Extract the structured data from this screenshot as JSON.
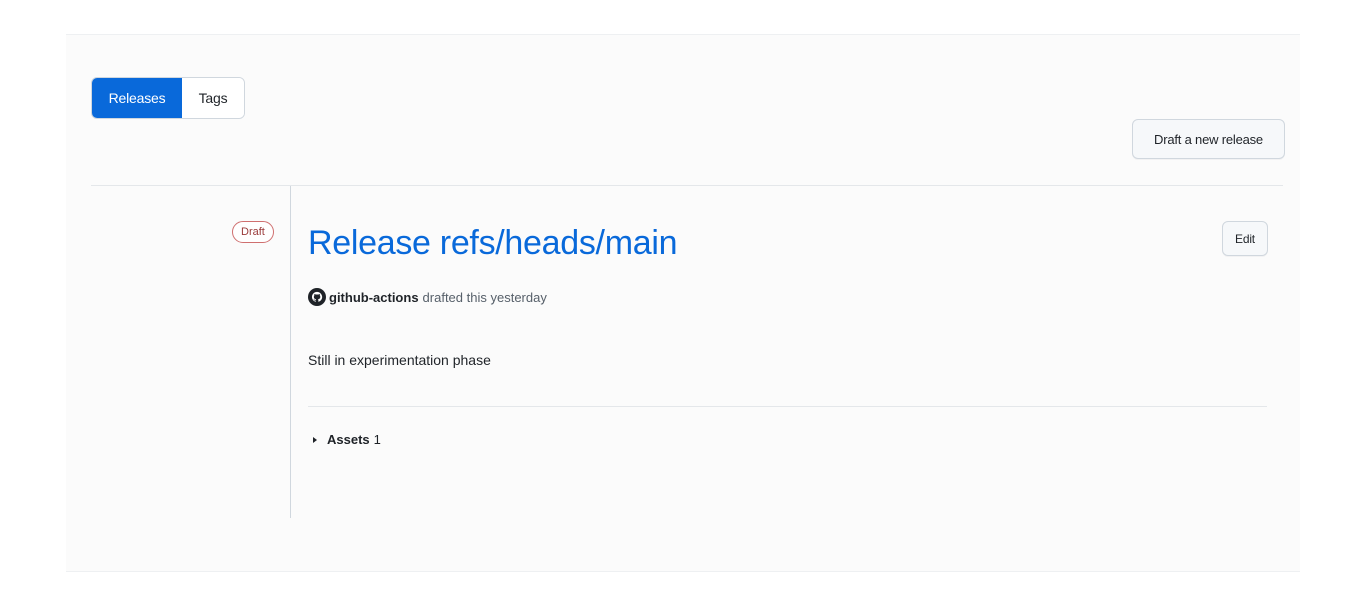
{
  "subnav": {
    "releases_label": "Releases",
    "tags_label": "Tags"
  },
  "actions": {
    "draft_new_release_label": "Draft a new release"
  },
  "release": {
    "status_badge": "Draft",
    "title": "Release refs/heads/main",
    "author": "github-actions",
    "byline_suffix": "drafted this yesterday",
    "body": "Still in experimentation phase",
    "edit_label": "Edit",
    "assets_label": "Assets",
    "assets_count": "1"
  },
  "colors": {
    "accent": "#0969da",
    "draft_badge": "#cf6f6f"
  },
  "icons": {
    "avatar": "github-avatar-icon",
    "assets_toggle": "caret-right-icon"
  }
}
